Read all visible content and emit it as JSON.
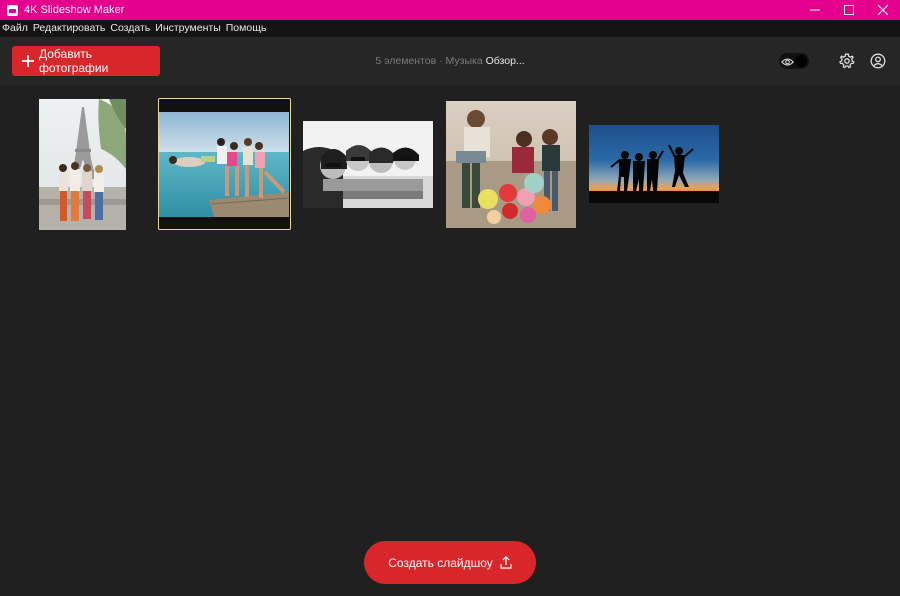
{
  "window": {
    "title": "4K Slideshow Maker",
    "accent": "#e4008c",
    "controls": [
      "minimize-icon",
      "maximize-icon",
      "close-icon"
    ]
  },
  "menu": {
    "items": [
      "Файл",
      "Редактировать",
      "Создать",
      "Инструменты",
      "Помощь"
    ]
  },
  "toolbar": {
    "add_photos_label": "Добавить фотографии",
    "add_button_color": "#d8262b",
    "items_count_text": "5 элементов",
    "separator": " · ",
    "music_label": "Музыка",
    "music_value": "Обзор...",
    "icons": [
      "eye-icon",
      "gear-icon",
      "account-icon"
    ]
  },
  "photos": [
    {
      "name": "eiffel-tower-friends",
      "selected": false
    },
    {
      "name": "beach-pier-friends",
      "selected": true
    },
    {
      "name": "bw-friends-lying",
      "selected": false
    },
    {
      "name": "friends-with-balloons",
      "selected": false
    },
    {
      "name": "sunset-silhouettes",
      "selected": false
    }
  ],
  "footer": {
    "create_label": "Создать слайдшоу",
    "create_icon": "upload-icon"
  }
}
